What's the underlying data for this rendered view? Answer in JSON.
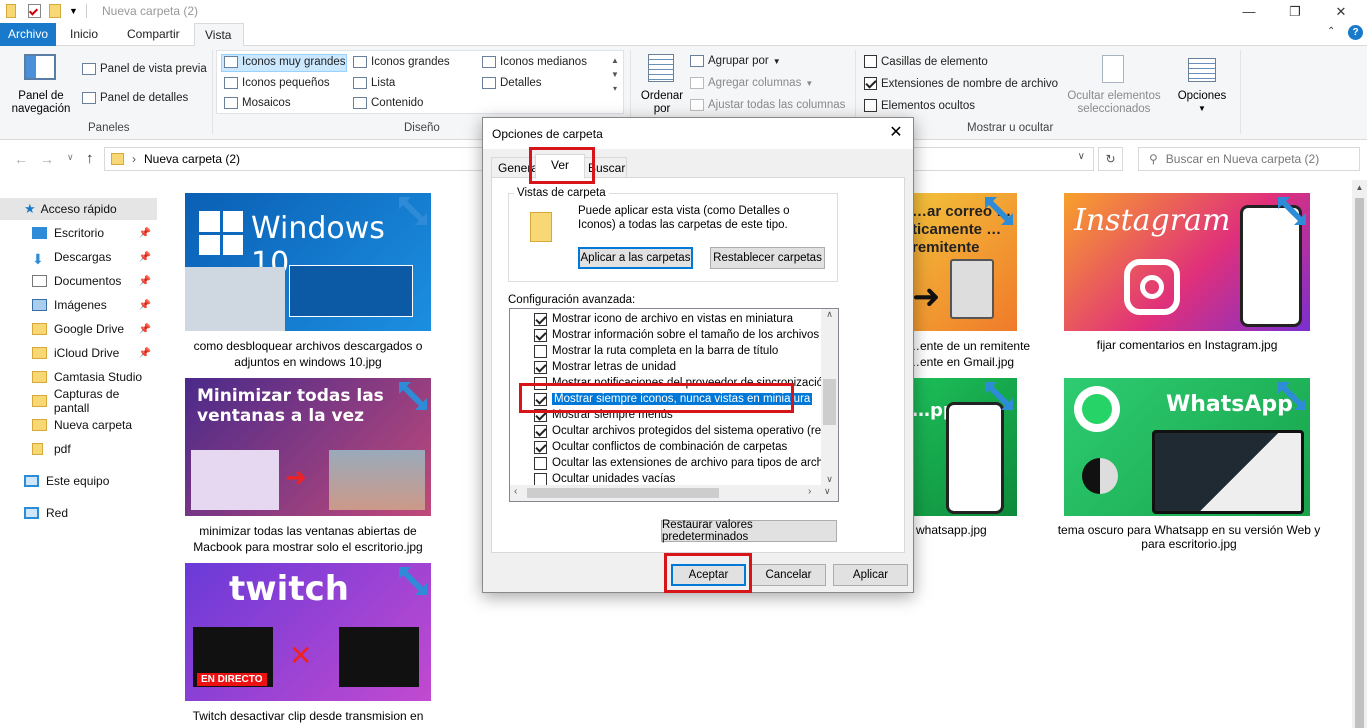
{
  "window": {
    "title": "Nueva carpeta (2)"
  },
  "tabs": [
    "Archivo",
    "Inicio",
    "Compartir",
    "Vista"
  ],
  "ribbon": {
    "panes": {
      "nav_pane": "Panel de navegación",
      "preview_pane": "Panel de vista previa",
      "details_pane": "Panel de detalles",
      "group": "Paneles"
    },
    "layout": {
      "items": [
        "Iconos muy grandes",
        "Iconos grandes",
        "Iconos medianos",
        "Iconos pequeños",
        "Lista",
        "Detalles",
        "Mosaicos",
        "Contenido"
      ],
      "group": "Diseño"
    },
    "current_view": {
      "sort_by": "Ordenar por",
      "group_by": "Agrupar por",
      "add_columns": "Agregar columnas",
      "fit_columns": "Ajustar todas las columnas"
    },
    "show_hide": {
      "item_checkboxes": "Casillas de elemento",
      "file_extensions": "Extensiones de nombre de archivo",
      "hidden_items": "Elementos ocultos",
      "hide_selected": "Ocultar elementos seleccionados",
      "options": "Opciones",
      "group": "Mostrar u ocultar"
    }
  },
  "address": {
    "path": "Nueva carpeta (2)",
    "search_placeholder": "Buscar en Nueva carpeta (2)"
  },
  "sidebar": [
    {
      "label": "Acceso rápido",
      "pinned": false
    },
    {
      "label": "Escritorio",
      "pinned": true
    },
    {
      "label": "Descargas",
      "pinned": true
    },
    {
      "label": "Documentos",
      "pinned": true
    },
    {
      "label": "Imágenes",
      "pinned": true
    },
    {
      "label": "Google Drive",
      "pinned": true
    },
    {
      "label": "iCloud Drive",
      "pinned": true
    },
    {
      "label": "Camtasia Studio",
      "pinned": false
    },
    {
      "label": "Capturas de pantall",
      "pinned": false
    },
    {
      "label": "Nueva carpeta",
      "pinned": false
    },
    {
      "label": "pdf",
      "pinned": false
    },
    {
      "label": "Este equipo",
      "pinned": false
    },
    {
      "label": "Red",
      "pinned": false
    }
  ],
  "files": [
    {
      "name": "como desbloquear archivos descargados o adjuntos en windows 10.jpg",
      "thumb_text": "Windows 10"
    },
    {
      "name": "minimizar todas las ventanas abiertas de Macbook para mostrar solo el escritorio.jpg",
      "thumb_text": "Minimizar todas las ventanas a la vez"
    },
    {
      "name": "Twitch desactivar clip desde transmision en",
      "thumb_text": "twitch",
      "thumb_sub": "EN DIRECTO"
    },
    {
      "name": "…ar correo …ticamente …remitente",
      "caption_partial": [
        "…ente de un remitente",
        "…ente en Gmail.jpg"
      ]
    },
    {
      "name": "whatsapp.jpg",
      "thumb_text": "…pp"
    },
    {
      "name": "fijar comentarios en Instagram.jpg",
      "thumb_text": "Instagram"
    },
    {
      "name": "tema oscuro para Whatsapp en su versión Web y para escritorio.jpg",
      "thumb_text": "WhatsApp"
    }
  ],
  "dialog": {
    "title": "Opciones de carpeta",
    "tabs": [
      "General",
      "Ver",
      "Buscar"
    ],
    "folder_views": {
      "legend": "Vistas de carpeta",
      "text": "Puede aplicar esta vista (como Detalles o Iconos) a todas las carpetas de este tipo.",
      "apply": "Aplicar a las carpetas",
      "reset": "Restablecer carpetas"
    },
    "advanced_label": "Configuración avanzada:",
    "advanced": [
      {
        "label": "Mostrar icono de archivo en vistas en miniatura",
        "checked": true
      },
      {
        "label": "Mostrar información sobre el tamaño de los archivos en re",
        "checked": true
      },
      {
        "label": "Mostrar la ruta completa en la barra de título",
        "checked": false
      },
      {
        "label": "Mostrar letras de unidad",
        "checked": true
      },
      {
        "label": "Mostrar notificaciones del proveedor de sincronización",
        "checked": false
      },
      {
        "label": "Mostrar siempre iconos, nunca vistas en miniatura",
        "checked": true,
        "selected": true
      },
      {
        "label": "Mostrar siempre menús",
        "checked": true
      },
      {
        "label": "Ocultar archivos protegidos del sistema operativo (recome",
        "checked": true
      },
      {
        "label": "Ocultar conflictos de combinación de carpetas",
        "checked": true
      },
      {
        "label": "Ocultar las extensiones de archivo para tipos de archivo c",
        "checked": false
      },
      {
        "label": "Ocultar unidades vacías",
        "checked": false
      }
    ],
    "restore": "Restaurar valores predeterminados",
    "ok": "Aceptar",
    "cancel": "Cancelar",
    "apply": "Aplicar"
  },
  "colors": {
    "accent": "#1979ca",
    "highlight": "#d7141a",
    "selection": "#0078d7"
  }
}
